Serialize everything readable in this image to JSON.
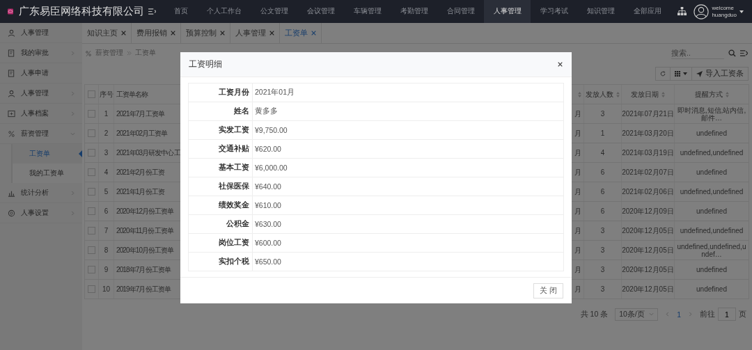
{
  "app": {
    "title": "广东易臣网络科技有限公司"
  },
  "nav": [
    {
      "label": "首页",
      "selected": false
    },
    {
      "label": "个人工作台",
      "selected": false
    },
    {
      "label": "公文管理",
      "selected": false
    },
    {
      "label": "会议管理",
      "selected": false
    },
    {
      "label": "车辆管理",
      "selected": false
    },
    {
      "label": "考勤管理",
      "selected": false
    },
    {
      "label": "合同管理",
      "selected": false
    },
    {
      "label": "人事管理",
      "selected": true
    },
    {
      "label": "学习考试",
      "selected": false
    },
    {
      "label": "知识管理",
      "selected": false
    },
    {
      "label": "全部应用",
      "selected": false
    }
  ],
  "user": {
    "greeting": "welcome",
    "name": "huangduo"
  },
  "sidebar": {
    "items": [
      {
        "label": "人事管理",
        "kind": "link"
      },
      {
        "label": "我的审批",
        "kind": "group",
        "expanded": false
      },
      {
        "label": "人事申请",
        "kind": "link"
      },
      {
        "label": "人事管理",
        "kind": "group",
        "expanded": false
      },
      {
        "label": "人事档案",
        "kind": "group",
        "expanded": false
      },
      {
        "label": "薪资管理",
        "kind": "group",
        "expanded": true,
        "children": [
          {
            "label": "工资单",
            "selected": true
          },
          {
            "label": "我的工资单",
            "selected": false
          }
        ]
      },
      {
        "label": "统计分析",
        "kind": "group",
        "expanded": false
      },
      {
        "label": "人事设置",
        "kind": "group",
        "expanded": false
      }
    ]
  },
  "tabs": [
    {
      "label": "知识主页",
      "selected": false
    },
    {
      "label": "费用报销",
      "selected": false
    },
    {
      "label": "预算控制",
      "selected": false
    },
    {
      "label": "人事管理",
      "selected": false
    },
    {
      "label": "工资单",
      "selected": true
    }
  ],
  "breadcrumb": [
    "薪资管理",
    "工资单"
  ],
  "search": {
    "placeholder": "搜索.."
  },
  "toolbar": {
    "import_button": "导入工资条"
  },
  "table": {
    "all_checked": false,
    "columns": [
      {
        "label": "序号",
        "sortable": false
      },
      {
        "label": "工资单名称",
        "sortable": false
      },
      {
        "sortable": true
      },
      {
        "label": "发放人数",
        "sortable": true
      },
      {
        "label": "发放日期",
        "sortable": true
      },
      {
        "label": "提醒方式",
        "sortable": true
      }
    ],
    "rows": [
      {
        "checked": false,
        "index": "1",
        "name": "2021年7月工资单",
        "column_3": "月",
        "count": "3",
        "date": "2021年07月21日",
        "reminder": "即时消息,短信,站内信,邮件…"
      },
      {
        "checked": false,
        "index": "2",
        "name": "2021年02月工资单",
        "column_3": "月",
        "count": "1",
        "date": "2021年03月20日",
        "reminder": "undefined"
      },
      {
        "checked": false,
        "index": "3",
        "name": "2021年03月研发中心工",
        "column_3": "月",
        "count": "4",
        "date": "2021年03月19日",
        "reminder": "undefined,undefined"
      },
      {
        "checked": false,
        "index": "4",
        "name": "2021年2月份工资",
        "column_3": "月",
        "count": "6",
        "date": "2021年02月07日",
        "reminder": "undefined"
      },
      {
        "checked": false,
        "index": "5",
        "name": "2021年1月份工资",
        "column_3": "月",
        "count": "6",
        "date": "2021年02月06日",
        "reminder": "undefined,undefined"
      },
      {
        "checked": false,
        "index": "6",
        "name": "2020年12月份工资单",
        "column_3": "月",
        "count": "6",
        "date": "2020年12月09日",
        "reminder": "undefined"
      },
      {
        "checked": false,
        "index": "7",
        "name": "2020年11月份工资单",
        "column_3": "月",
        "count": "3",
        "date": "2020年12月05日",
        "reminder": "undefined,undefined"
      },
      {
        "checked": false,
        "index": "8",
        "name": "2020年10月份工资单",
        "column_3": "月",
        "count": "3",
        "date": "2020年12月05日",
        "reminder": "undefined,undefined,undef…"
      },
      {
        "checked": false,
        "index": "9",
        "name": "2018年7月份工资单",
        "column_3": "月",
        "count": "3",
        "date": "2020年12月05日",
        "reminder": "undefined"
      },
      {
        "checked": false,
        "index": "10",
        "name": "2019年7月份工资单",
        "column_3": "月",
        "count": "3",
        "date": "2020年12月05日",
        "reminder": "undefined"
      }
    ]
  },
  "pagination": {
    "total": "共 10 条",
    "page_size": "10条/页",
    "current": "1",
    "goto_label": "前往",
    "goto_value": "1",
    "page_suffix": "页"
  },
  "modal": {
    "title": "工资明细",
    "fields": [
      {
        "label": "工资月份",
        "value": "2021年01月"
      },
      {
        "label": "姓名",
        "value": "黄多多"
      },
      {
        "label": "实发工资",
        "value": "¥9,750.00"
      },
      {
        "label": "交通补贴",
        "value": "¥620.00"
      },
      {
        "label": "基本工资",
        "value": "¥6,000.00"
      },
      {
        "label": "社保医保",
        "value": "¥640.00"
      },
      {
        "label": "绩效奖金",
        "value": "¥610.00"
      },
      {
        "label": "公积金",
        "value": "¥630.00"
      },
      {
        "label": "岗位工资",
        "value": "¥600.00"
      },
      {
        "label": "实扣个税",
        "value": "¥650.00"
      }
    ],
    "close_button": "关 闭"
  }
}
